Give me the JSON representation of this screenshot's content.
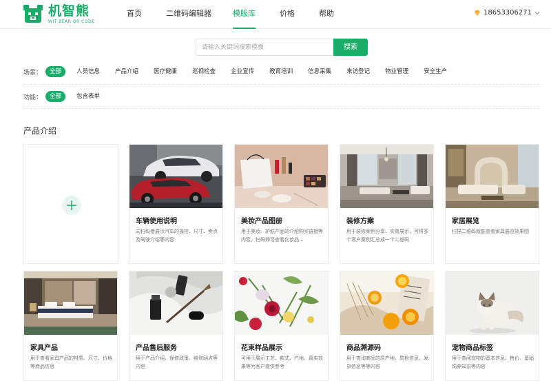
{
  "header": {
    "logo_name": "机智熊",
    "logo_sub": "WIT BEAR QR CODE",
    "nav": [
      "首页",
      "二维码编辑器",
      "模版库",
      "价格",
      "帮助"
    ],
    "active_nav": "模版库",
    "user_phone": "18653306271"
  },
  "search": {
    "placeholder": "请输入关键词搜索模板",
    "button": "搜索"
  },
  "filters": {
    "scene_label": "场景：",
    "scene_items": [
      "全部",
      "人员信息",
      "产品介绍",
      "医疗健康",
      "巡视检查",
      "企业宣传",
      "教育培训",
      "信息采集",
      "来访登记",
      "物业管理",
      "安全生产"
    ],
    "function_label": "功能：",
    "function_items": [
      "全部",
      "包含表单"
    ]
  },
  "section_title": "产品介绍",
  "cards": [
    {
      "title": "车辆使用说明",
      "desc": "向扫码者展示汽车的操控、尺寸、卖点及驾驶介绍等内容"
    },
    {
      "title": "美妆产品图册",
      "desc": "用于美妆、护肤产品的介绍购买链接等内容，扫码即可查看化妆品..."
    },
    {
      "title": "装修方案",
      "desc": "用于装修案例分享、实景展示，可将多个客户案例汇总成一个二维码"
    },
    {
      "title": "家居展览",
      "desc": "扫描二维码就能查看家具展览效果图"
    },
    {
      "title": "家具产品",
      "desc": "用于查看家具产品的材质、尺寸、价格等商品信息"
    },
    {
      "title": "产品售后服务",
      "desc": "用于产品介绍、保修政策、维修网点等内容"
    },
    {
      "title": "花束样品展示",
      "desc": "可用于展示工艺、款式、产地、真实效果等为客户提供参考"
    },
    {
      "title": "商品溯源码",
      "desc": "用于查询商品的原产地、质检信息、发货信息等等内容"
    },
    {
      "title": "宠物商品标签",
      "desc": "用于查阅宠物的基本信息、售价、基础饲养知识等内容"
    }
  ],
  "colors": {
    "accent": "#1aad6a"
  }
}
